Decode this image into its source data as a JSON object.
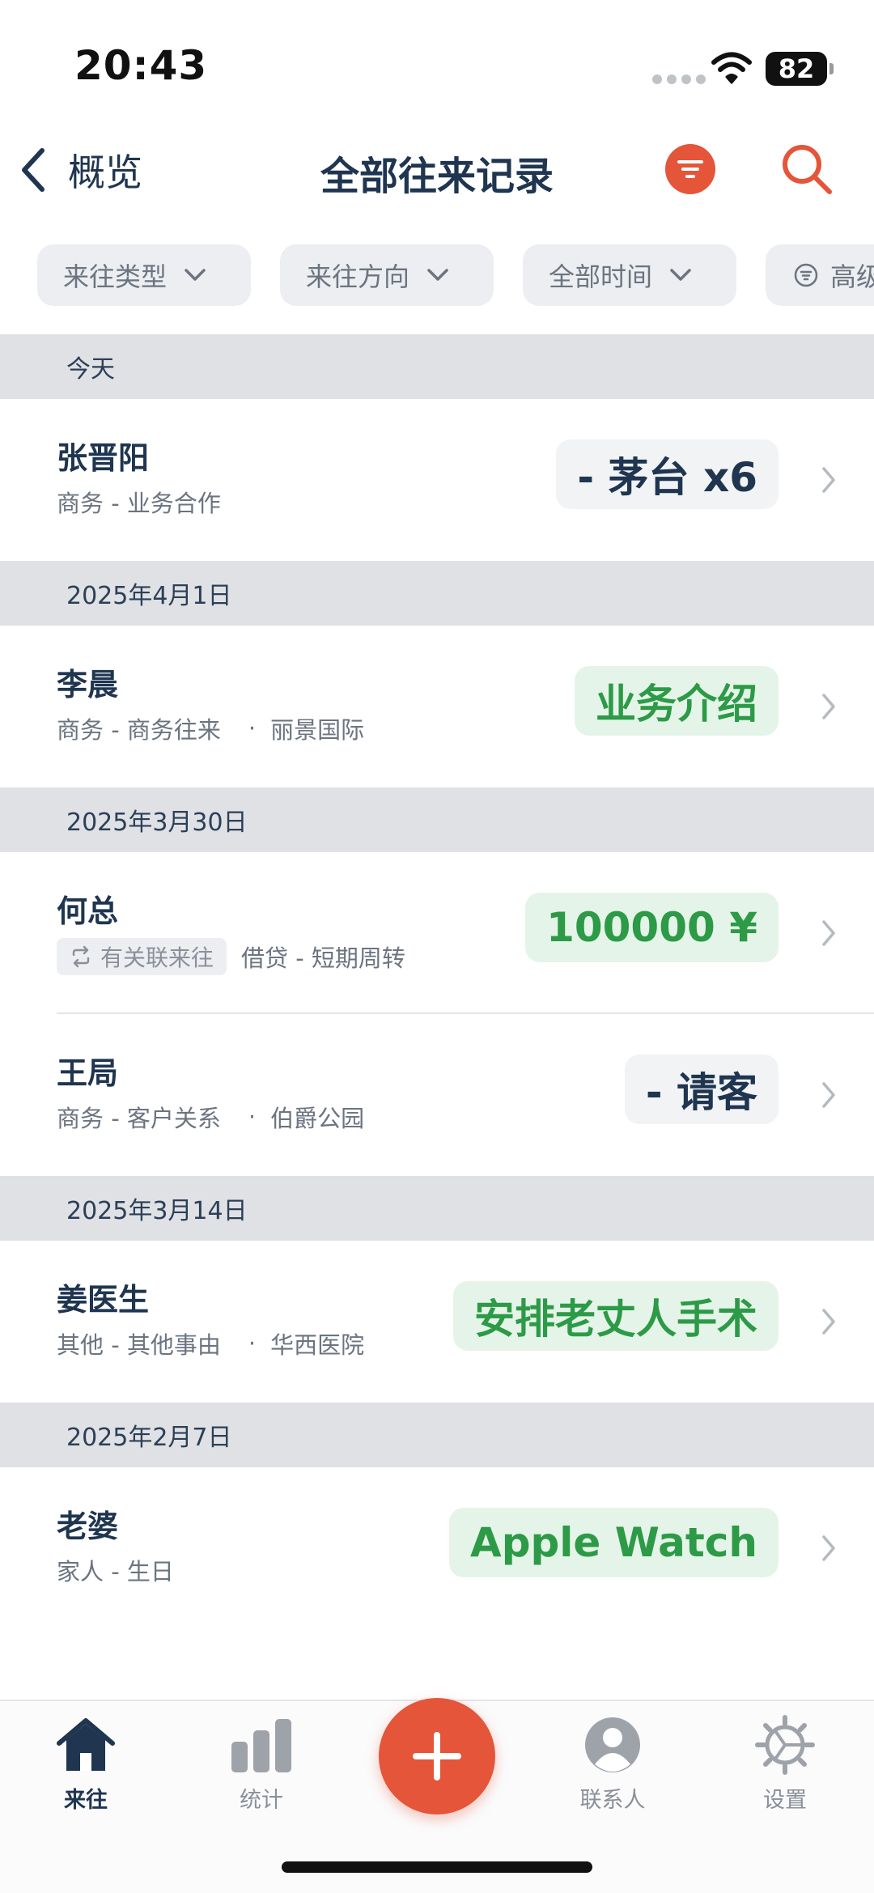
{
  "status_bar": {
    "time": "20:43",
    "battery": "82"
  },
  "nav": {
    "back_label": "概览",
    "title": "全部往来记录",
    "icons": {
      "back": "chevron-left-icon",
      "filter": "filter-icon",
      "search": "search-icon"
    }
  },
  "filters": [
    {
      "label": "来往类型"
    },
    {
      "label": "来往方向"
    },
    {
      "label": "全部时间"
    },
    {
      "label": "高级"
    }
  ],
  "sections": [
    {
      "date": "今天",
      "records": [
        {
          "name": "张晋阳",
          "category": "商务 - 业务合作",
          "location": "",
          "amount": "- 茅台 x6",
          "style": "neutral",
          "linked": ""
        }
      ]
    },
    {
      "date": "2025年4月1日",
      "records": [
        {
          "name": "李晨",
          "category": "商务 - 商务往来",
          "location": "丽景国际",
          "amount": "业务介绍",
          "style": "green",
          "linked": ""
        }
      ]
    },
    {
      "date": "2025年3月30日",
      "records": [
        {
          "name": "何总",
          "category": "借贷 - 短期周转",
          "location": "",
          "amount": "100000 ¥",
          "style": "green",
          "linked": "有关联来往"
        },
        {
          "name": "王局",
          "category": "商务 - 客户关系",
          "location": "伯爵公园",
          "amount": "- 请客",
          "style": "neutral",
          "linked": ""
        }
      ]
    },
    {
      "date": "2025年3月14日",
      "records": [
        {
          "name": "姜医生",
          "category": "其他 - 其他事由",
          "location": "华西医院",
          "amount": "安排老丈人手术",
          "style": "green",
          "linked": ""
        }
      ]
    },
    {
      "date": "2025年2月7日",
      "records": [
        {
          "name": "老婆",
          "category": "家人 - 生日",
          "location": "",
          "amount": "Apple Watch",
          "style": "green",
          "linked": ""
        }
      ]
    }
  ],
  "tabs": [
    {
      "label": "来往",
      "icon": "home-icon",
      "active": true
    },
    {
      "label": "统计",
      "icon": "bar-chart-icon",
      "active": false
    },
    {
      "label": "联系人",
      "icon": "person-icon",
      "active": false
    },
    {
      "label": "设置",
      "icon": "gear-icon",
      "active": false
    }
  ],
  "fab": {
    "icon": "plus-icon"
  },
  "colors": {
    "accent": "#e4553a",
    "navy": "#1f3550",
    "green": "#2c9a46",
    "green_bg": "#e5f4e8"
  }
}
